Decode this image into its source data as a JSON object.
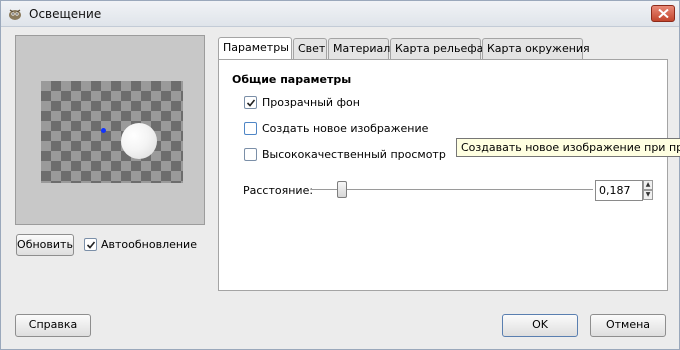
{
  "window": {
    "title": "Освещение"
  },
  "preview": {
    "update_button": "Обновить",
    "auto_update_label": "Автообновление",
    "auto_update_checked": true
  },
  "tabs": [
    {
      "label": "Параметры",
      "active": true
    },
    {
      "label": "Свет",
      "active": false
    },
    {
      "label": "Материал",
      "active": false
    },
    {
      "label": "Карта рельефа",
      "active": false
    },
    {
      "label": "Карта окружения",
      "active": false
    }
  ],
  "general": {
    "section_title": "Общие параметры",
    "options": [
      {
        "label": "Прозрачный фон",
        "checked": true
      },
      {
        "label": "Создать новое изображение",
        "checked": false
      },
      {
        "label": "Высококачественный просмотр",
        "checked": false
      }
    ],
    "distance": {
      "label": "Расстояние:",
      "value": "0,187"
    }
  },
  "tooltip": {
    "text": "Создавать новое изображение при прим"
  },
  "buttons": {
    "help": "Справка",
    "ok": "OK",
    "cancel": "Отмена"
  }
}
